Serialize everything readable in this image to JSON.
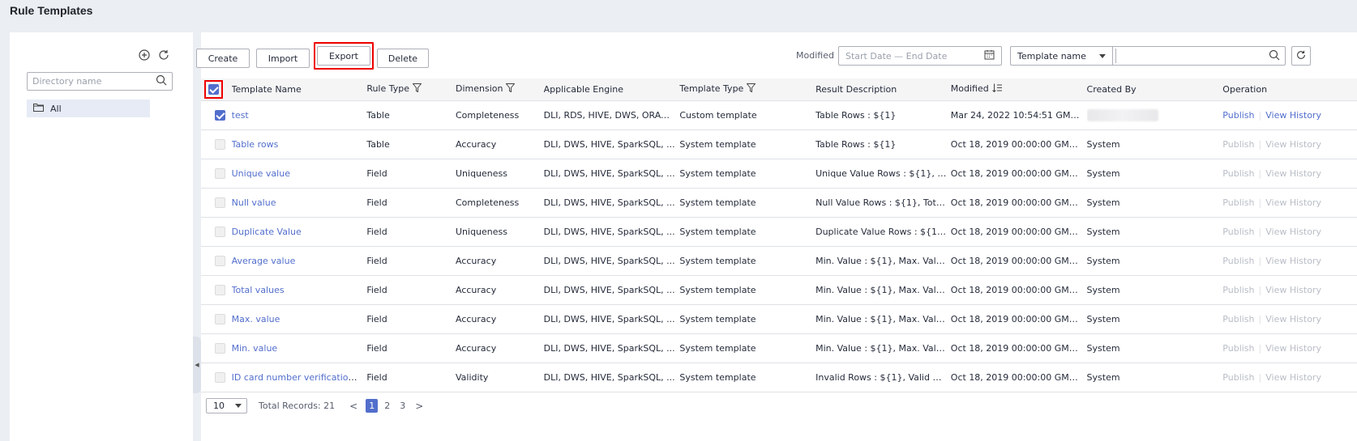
{
  "page": {
    "title": "Rule Templates"
  },
  "sidebar": {
    "search_placeholder": "Directory name",
    "tree": [
      {
        "label": "All"
      }
    ],
    "icons": [
      "add-circle-icon",
      "refresh-icon",
      "search-icon",
      "folder-icon"
    ]
  },
  "toolbar": {
    "create": "Create",
    "import": "Import",
    "export": "Export",
    "delete": "Delete",
    "modified_label": "Modified",
    "date_placeholder": "Start Date — End Date",
    "search_field": "Template name",
    "highlight_color": "#e00000"
  },
  "table": {
    "columns": [
      "Template Name",
      "Rule Type",
      "Dimension",
      "Applicable Engine",
      "Template Type",
      "Result Description",
      "Modified",
      "Created By",
      "Operation"
    ],
    "rows": [
      {
        "name": "test",
        "rule_type": "Table",
        "dimension": "Completeness",
        "engine": "DLI, RDS, HIVE, DWS, ORACLE",
        "template_type": "Custom template",
        "result": "Table Rows : ${1}",
        "modified": "Mar 24, 2022 10:54:51 GMT...",
        "created_by": "",
        "checked": true,
        "ops_enabled": true
      },
      {
        "name": "Table rows",
        "rule_type": "Table",
        "dimension": "Accuracy",
        "engine": "DLI, DWS, HIVE, SparkSQL, ...",
        "template_type": "System template",
        "result": "Table Rows : ${1}",
        "modified": "Oct 18, 2019 00:00:00 GMT+...",
        "created_by": "System",
        "checked": false,
        "ops_enabled": false
      },
      {
        "name": "Unique value",
        "rule_type": "Field",
        "dimension": "Uniqueness",
        "engine": "DLI, DWS, HIVE, SparkSQL, ...",
        "template_type": "System template",
        "result": "Unique Value Rows : ${1}, T...",
        "modified": "Oct 18, 2019 00:00:00 GMT+...",
        "created_by": "System",
        "checked": false,
        "ops_enabled": false
      },
      {
        "name": "Null value",
        "rule_type": "Field",
        "dimension": "Completeness",
        "engine": "DLI, DWS, HIVE, SparkSQL, ...",
        "template_type": "System template",
        "result": "Null Value Rows : ${1}, Total...",
        "modified": "Oct 18, 2019 00:00:00 GMT+...",
        "created_by": "System",
        "checked": false,
        "ops_enabled": false
      },
      {
        "name": "Duplicate Value",
        "rule_type": "Field",
        "dimension": "Uniqueness",
        "engine": "DLI, DWS, HIVE, SparkSQL, ...",
        "template_type": "System template",
        "result": "Duplicate Value Rows : ${1},...",
        "modified": "Oct 18, 2019 00:00:00 GMT+...",
        "created_by": "System",
        "checked": false,
        "ops_enabled": false
      },
      {
        "name": "Average value",
        "rule_type": "Field",
        "dimension": "Accuracy",
        "engine": "DLI, DWS, HIVE, SparkSQL, ...",
        "template_type": "System template",
        "result": "Min. Value : ${1}, Max. Valu...",
        "modified": "Oct 18, 2019 00:00:00 GMT+...",
        "created_by": "System",
        "checked": false,
        "ops_enabled": false
      },
      {
        "name": "Total values",
        "rule_type": "Field",
        "dimension": "Accuracy",
        "engine": "DLI, DWS, HIVE, SparkSQL, ...",
        "template_type": "System template",
        "result": "Min. Value : ${1}, Max. Valu...",
        "modified": "Oct 18, 2019 00:00:00 GMT+...",
        "created_by": "System",
        "checked": false,
        "ops_enabled": false
      },
      {
        "name": "Max. value",
        "rule_type": "Field",
        "dimension": "Accuracy",
        "engine": "DLI, DWS, HIVE, SparkSQL, ...",
        "template_type": "System template",
        "result": "Min. Value : ${1}, Max. Valu...",
        "modified": "Oct 18, 2019 00:00:00 GMT+...",
        "created_by": "System",
        "checked": false,
        "ops_enabled": false
      },
      {
        "name": "Min. value",
        "rule_type": "Field",
        "dimension": "Accuracy",
        "engine": "DLI, DWS, HIVE, SparkSQL, ...",
        "template_type": "System template",
        "result": "Min. Value : ${1}, Max. Valu...",
        "modified": "Oct 18, 2019 00:00:00 GMT+...",
        "created_by": "System",
        "checked": false,
        "ops_enabled": false
      },
      {
        "name": "ID card number verification[...",
        "rule_type": "Field",
        "dimension": "Validity",
        "engine": "DLI, DWS, HIVE, SparkSQL, ...",
        "template_type": "System template",
        "result": "Invalid Rows : ${1}, Valid Ro...",
        "modified": "Oct 18, 2019 00:00:00 GMT+...",
        "created_by": "System",
        "checked": false,
        "ops_enabled": false
      }
    ],
    "op_publish": "Publish",
    "op_history": "View History"
  },
  "pagination": {
    "page_size": "10",
    "total": "Total Records: 21",
    "pages": [
      "1",
      "2",
      "3"
    ],
    "current": "1",
    "prev": "<",
    "next": ">"
  }
}
